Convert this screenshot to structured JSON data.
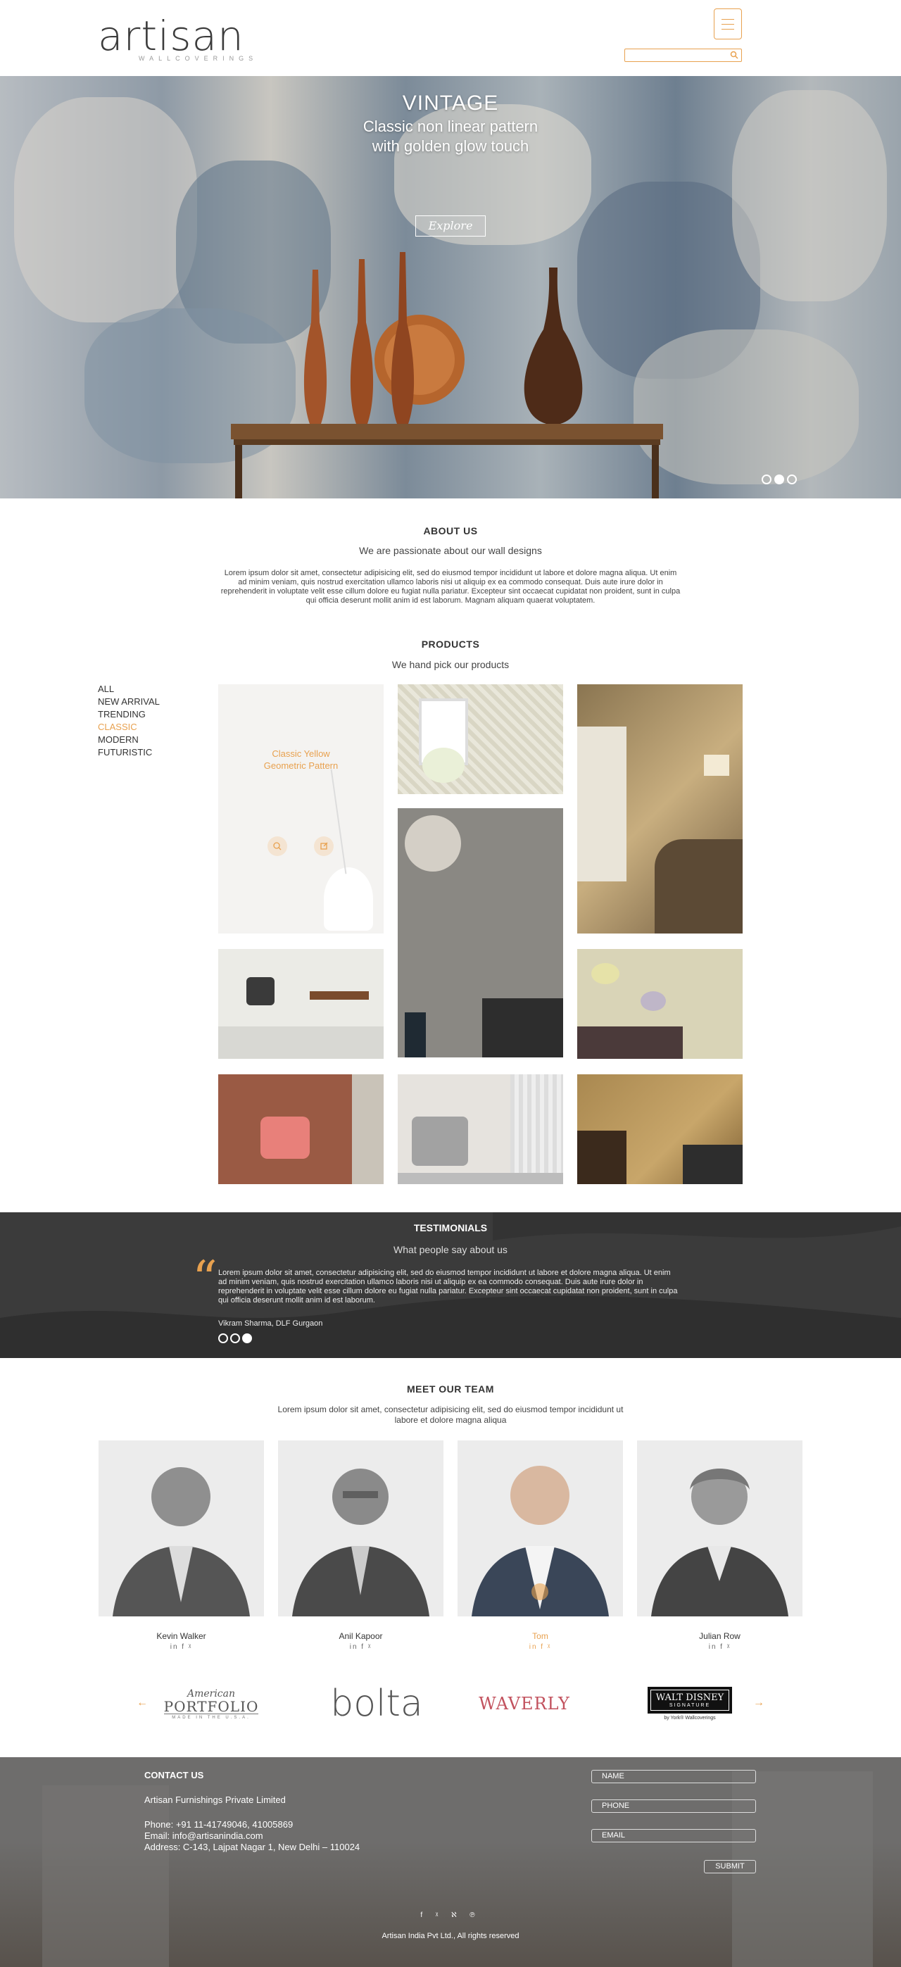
{
  "header": {
    "logo_text": "artisan",
    "logo_sub": "WALLCOVERINGS",
    "search_placeholder": ""
  },
  "hero": {
    "title": "VINTAGE",
    "subtitle_line1": "Classic non linear pattern",
    "subtitle_line2": "with golden glow touch",
    "button_label": "Explore",
    "slides_count": 3,
    "active_slide": 2
  },
  "about": {
    "title": "ABOUT US",
    "subtitle": "We are passionate about our wall designs",
    "body": "Lorem ipsum dolor sit amet, consectetur adipisicing elit, sed do eiusmod tempor incididunt ut labore et dolore magna aliqua. Ut enim ad minim veniam, quis nostrud exercitation ullamco laboris nisi ut aliquip ex ea commodo consequat. Duis aute irure dolor in reprehenderit in voluptate velit esse cillum dolore eu fugiat nulla pariatur. Excepteur sint occaecat cupidatat non proident, sunt in culpa qui officia deserunt mollit anim id est laborum. Magnam aliquam quaerat voluptatem."
  },
  "products": {
    "title": "PRODUCTS",
    "subtitle": "We hand pick our products",
    "filters": [
      "ALL",
      "NEW ARRIVAL",
      "TRENDING",
      "CLASSIC",
      "MODERN",
      "FUTURISTIC"
    ],
    "active_filter": "CLASSIC",
    "featured_caption_line1": "Classic Yellow",
    "featured_caption_line2": "Geometric Pattern"
  },
  "testimonials": {
    "title": "TESTIMONIALS",
    "subtitle": "What people say about us",
    "quote": "Lorem ipsum dolor sit amet, consectetur adipisicing elit, sed do eiusmod tempor incididunt ut labore et dolore magna aliqua. Ut enim ad minim veniam, quis nostrud exercitation ullamco laboris nisi ut aliquip ex ea commodo consequat. Duis aute irure dolor in reprehenderit in voluptate velit esse cillum dolore eu fugiat nulla pariatur. Excepteur sint occaecat cupidatat non proident, sunt in culpa qui officia deserunt mollit anim id est laborum.",
    "author": "Vikram Sharma, DLF Gurgaon",
    "active_slide": 3
  },
  "team": {
    "title": "MEET OUR TEAM",
    "subtitle_line1": "Lorem ipsum dolor sit amet, consectetur adipisicing elit, sed do eiusmod tempor incididunt ut",
    "subtitle_line2": "labore et dolore magna aliqua",
    "members": [
      {
        "name": "Kevin Walker",
        "social": "in f ᵡ"
      },
      {
        "name": "Anil Kapoor",
        "social": "in f ᵡ"
      },
      {
        "name": "Tom",
        "social": "in f ᵡ"
      },
      {
        "name": "Julian Row",
        "social": "in f ᵡ"
      }
    ],
    "highlight_color": "#e8a14f"
  },
  "brands": {
    "portfolio_top": "American",
    "portfolio_main": "PORTFOLIO",
    "portfolio_bottom": "MADE IN THE U.S.A.",
    "bolta": "bolta",
    "waverly": "WAVERLY",
    "disney_main": "WALT DISNEY",
    "disney_sub": "SIGNATURE",
    "disney_foot": "by York® Wallcoverings"
  },
  "footer": {
    "contact_title": "CONTACT US",
    "company": "Artisan Furnishings Private Limited",
    "phone": "Phone: +91 11-41749046, 41005869",
    "email": "Email: info@artisanindia.com",
    "address": "Address: C-143, Lajpat Nagar 1, New Delhi – 110024",
    "form_name": "NAME",
    "form_phone": "PHONE",
    "form_email": "EMAIL",
    "submit_label": "SUBMIT",
    "social": "f ᵡ ℵ ℗",
    "copyright": "Artisan India Pvt Ltd., All rights reserved"
  },
  "colors": {
    "accent": "#e8a14f",
    "dark": "#3b3b3b",
    "footer": "#6e6d6c"
  }
}
